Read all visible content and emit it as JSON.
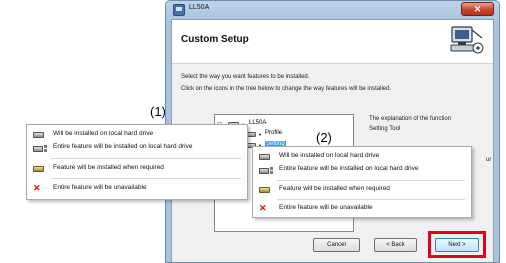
{
  "window": {
    "title": "LL50A",
    "close_glyph": "✕",
    "page_title": "Custom Setup"
  },
  "instructions": {
    "line1": "Select the way you want features to be installed.",
    "line2": "Click on the icons in the tree below to change the way features will be installed."
  },
  "tree": {
    "root": "LL50A",
    "child1": "Profile",
    "child2": "Setting"
  },
  "explanation": {
    "line1": "The explanation of the function",
    "line2": "Setting Tool",
    "partial": "ur"
  },
  "buttons": {
    "cancel": "Cancel",
    "back": "< Back",
    "next": "Next >"
  },
  "callout_labels": {
    "one": "(1)",
    "two": "(2)"
  },
  "menu_options": [
    {
      "label": "Will be installed on local hard drive",
      "icon": "hard-drive-icon"
    },
    {
      "label": "Entire feature will be installed on local hard drive",
      "icon": "hard-drive-all-icon"
    },
    {
      "label": "Feature will be installed when required",
      "icon": "install-on-demand-icon"
    },
    {
      "label": "Entire feature will be unavailable",
      "icon": "unavailable-x-icon"
    }
  ],
  "colors": {
    "highlight": "#e3001b",
    "selection": "#3399ff",
    "unavailable": "#d4140a"
  }
}
